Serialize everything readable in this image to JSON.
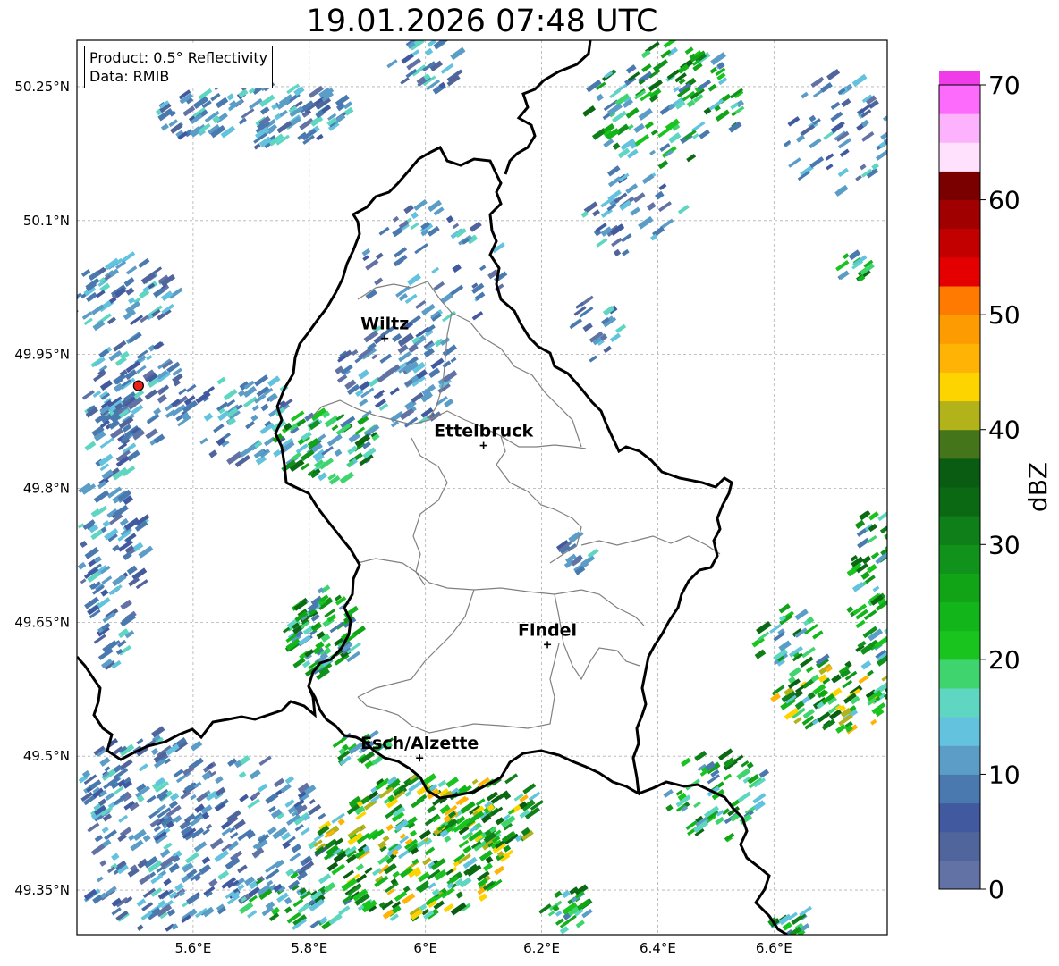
{
  "title": "19.01.2026 07:48 UTC",
  "info_box": {
    "product": "Product: 0.5° Reflectivity",
    "source": "Data: RMIB"
  },
  "lat_ticks": [
    {
      "value": 50.25,
      "label": "50.25°N"
    },
    {
      "value": 50.1,
      "label": "50.1°N"
    },
    {
      "value": 49.95,
      "label": "49.95°N"
    },
    {
      "value": 49.8,
      "label": "49.8°N"
    },
    {
      "value": 49.65,
      "label": "49.65°N"
    },
    {
      "value": 49.5,
      "label": "49.5°N"
    },
    {
      "value": 49.35,
      "label": "49.35°N"
    }
  ],
  "lon_ticks": [
    {
      "value": 5.6,
      "label": "5.6°E"
    },
    {
      "value": 5.8,
      "label": "5.8°E"
    },
    {
      "value": 6.0,
      "label": "6°E"
    },
    {
      "value": 6.2,
      "label": "6.2°E"
    },
    {
      "value": 6.4,
      "label": "6.4°E"
    },
    {
      "value": 6.6,
      "label": "6.6°E"
    }
  ],
  "extent": {
    "lon_min": 5.4,
    "lon_max": 6.795,
    "lat_min": 49.3,
    "lat_max": 50.302
  },
  "cities": [
    {
      "name": "Wiltz",
      "lon": 5.93,
      "lat": 49.968
    },
    {
      "name": "Ettelbruck",
      "lon": 6.1,
      "lat": 49.848
    },
    {
      "name": "Findel",
      "lon": 6.21,
      "lat": 49.625
    },
    {
      "name": "Esch/Alzette",
      "lon": 5.99,
      "lat": 49.498
    }
  ],
  "radar_site": {
    "lon": 5.506,
    "lat": 49.915,
    "color": "#e8221a"
  },
  "colorbar": {
    "label": "dBZ",
    "min": 0,
    "max": 70,
    "step": 2.5,
    "tick_labels": [
      "0",
      "10",
      "20",
      "30",
      "40",
      "50",
      "60",
      "70"
    ],
    "colors": [
      "#6272a4",
      "#4f659c",
      "#415a9f",
      "#4a79b0",
      "#5b9dc7",
      "#63c2dd",
      "#5fd6c2",
      "#3fd46e",
      "#1ac41f",
      "#12b51a",
      "#12a417",
      "#10921b",
      "#0f7f19",
      "#0b6913",
      "#0a5c12",
      "#44751a",
      "#b2b21a",
      "#fdd400",
      "#feb305",
      "#fd9b02",
      "#fe7a01",
      "#e40000",
      "#c20000",
      "#a00000",
      "#7a0000",
      "#ffe1fd",
      "#fdb2fd",
      "#fd6bfd",
      "#f03ce8"
    ]
  }
}
